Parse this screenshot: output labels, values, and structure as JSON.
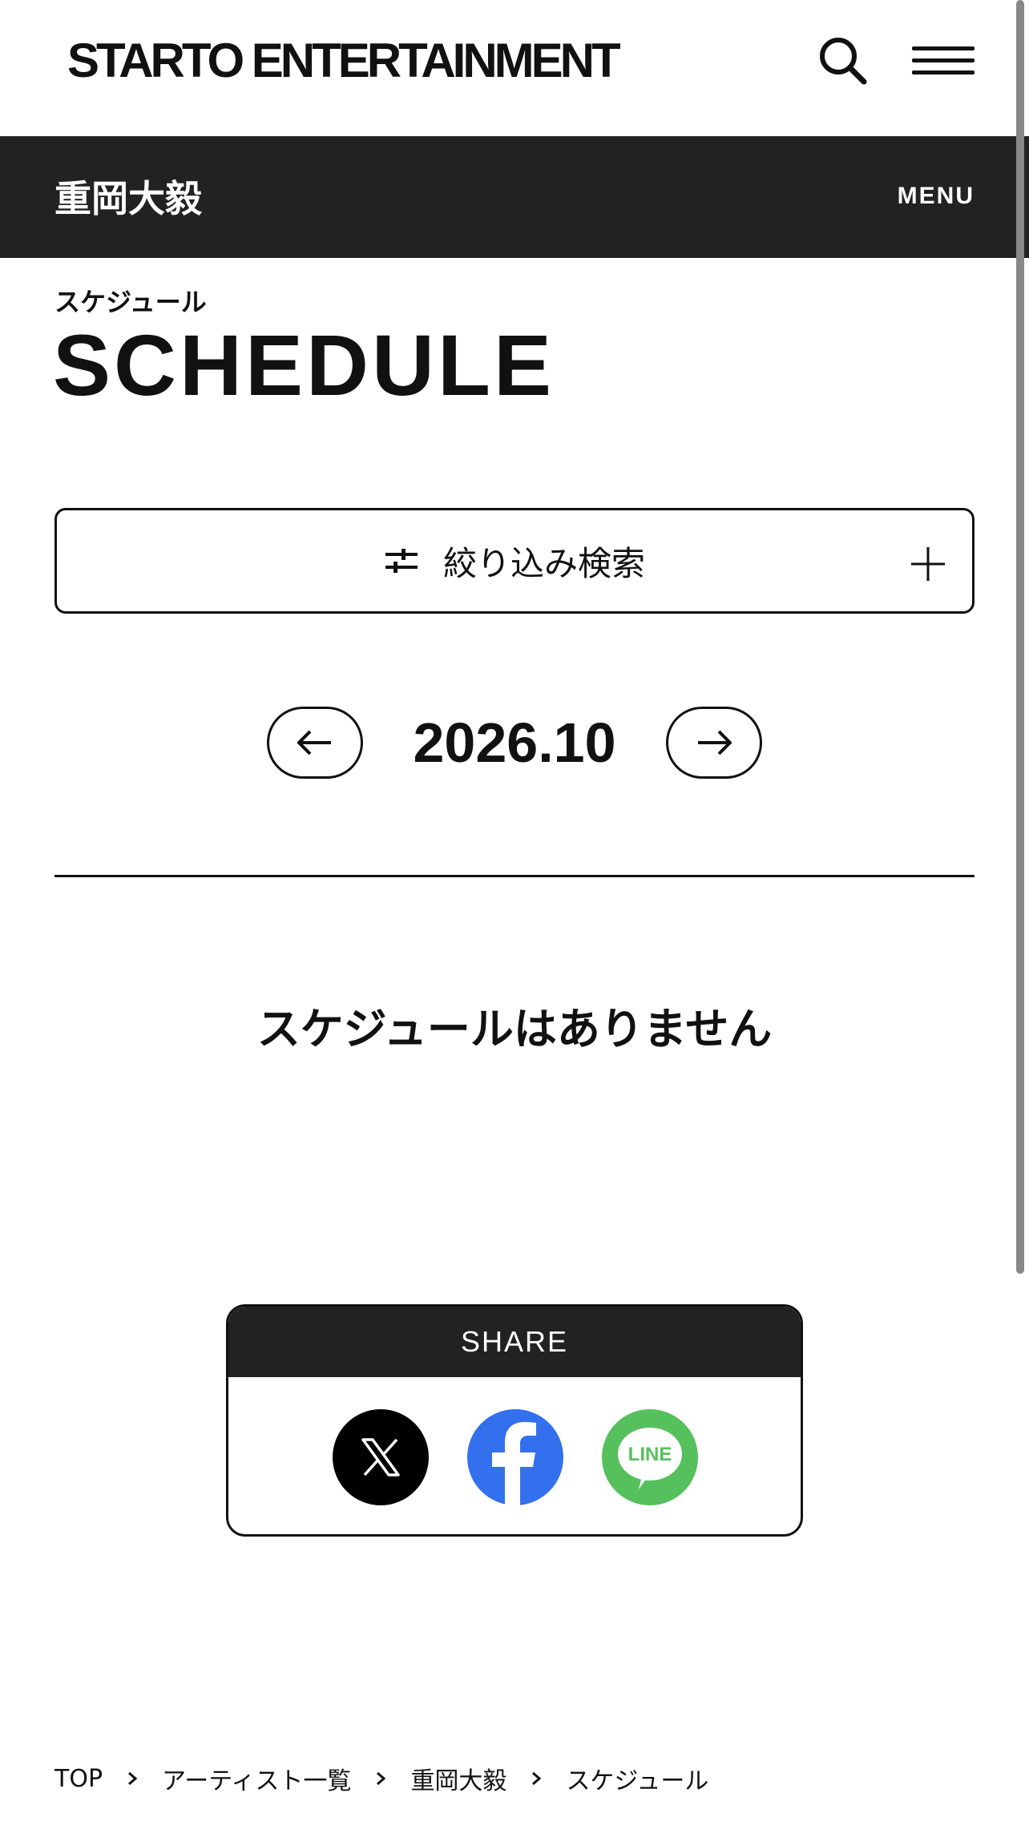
{
  "header": {
    "logo_text": "STARTO ENTERTAINMENT",
    "search_icon": "search-icon",
    "menu_icon": "hamburger-menu-icon"
  },
  "artist_bar": {
    "artist_name": "重岡大毅",
    "menu_label": "MENU"
  },
  "section": {
    "title_jp": "スケジュール",
    "title_en": "SCHEDULE"
  },
  "filter": {
    "label": "絞り込み検索",
    "icon": "sliders-icon",
    "toggle_icon": "plus-icon"
  },
  "month_nav": {
    "current": "2026.10",
    "prev_icon": "arrow-left-icon",
    "next_icon": "arrow-right-icon"
  },
  "empty_message": "スケジュールはありません",
  "share": {
    "heading": "SHARE",
    "items": [
      {
        "icon": "x-icon",
        "color": "#000000"
      },
      {
        "icon": "facebook-icon",
        "color": "#3270ed"
      },
      {
        "icon": "line-icon",
        "color": "#55c05c",
        "label": "LINE"
      }
    ]
  },
  "breadcrumb": {
    "items": [
      "TOP",
      "アーティスト一覧",
      "重岡大毅",
      "スケジュール"
    ]
  },
  "colors": {
    "dark_bar": "#222222",
    "text": "#111111"
  }
}
